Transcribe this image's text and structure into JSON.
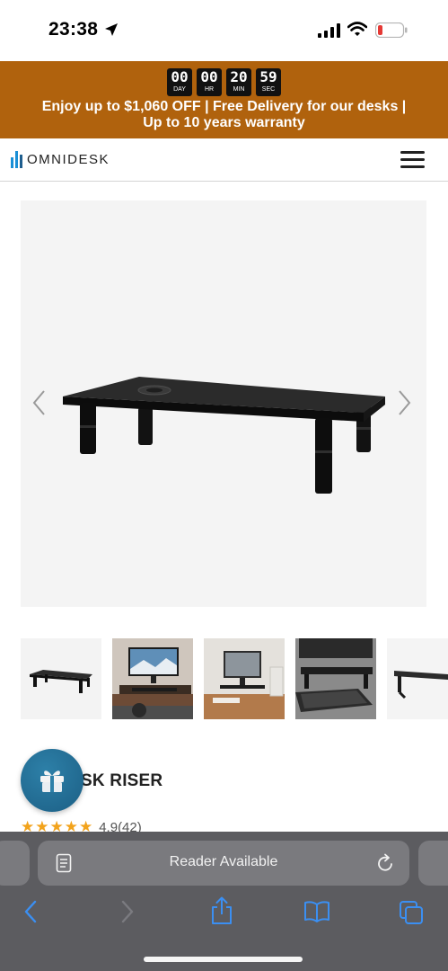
{
  "status_bar": {
    "time": "23:38",
    "icons": [
      "location-arrow-icon",
      "cellular-signal-icon",
      "wifi-icon",
      "battery-low-icon"
    ]
  },
  "banner": {
    "countdown": [
      {
        "value": "00",
        "label": "DAY"
      },
      {
        "value": "00",
        "label": "HR"
      },
      {
        "value": "20",
        "label": "MIN"
      },
      {
        "value": "59",
        "label": "SEC"
      }
    ],
    "promo_line1": "Enjoy up to $1,060 OFF | Free Delivery for our desks |",
    "promo_line2": "Up to 10 years warranty",
    "color": "#b0620d"
  },
  "header": {
    "logo_text": "OMNIDESK",
    "menu_icon": "hamburger-menu-icon",
    "accent": "#1a8fd6"
  },
  "gallery": {
    "prev_icon": "chevron-left-icon",
    "next_icon": "chevron-right-icon",
    "thumbnails": [
      "thumbnail-riser-product",
      "thumbnail-riser-tv-setup",
      "thumbnail-riser-monitor-desk",
      "thumbnail-riser-keyboard",
      "thumbnail-riser-side"
    ]
  },
  "product": {
    "title_visible": "SK RISER",
    "stars": "★★★★★",
    "rating": "4.9",
    "reviews": "(42)",
    "gift_icon": "gift-icon"
  },
  "safari": {
    "address_text": "Reader Available",
    "toolbar": [
      "back-icon",
      "forward-icon",
      "share-icon",
      "bookmarks-icon",
      "tabs-icon"
    ]
  }
}
